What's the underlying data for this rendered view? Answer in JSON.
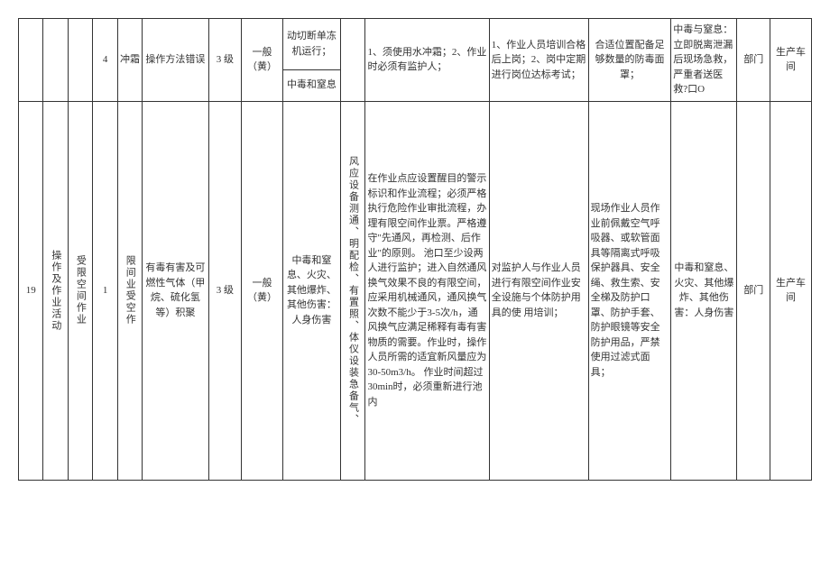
{
  "row0": {
    "c8": "动切断单冻机运行；"
  },
  "row1": {
    "c3": "4",
    "c4": "冲霜",
    "c5": "操作方法错误",
    "c6": "3 级",
    "c7": "一般（黄）",
    "c8": "中毒和窒息",
    "c9": "",
    "c10": "1、须使用水冲霜；2、作业时必须有监护人；",
    "c11": "1、作业人员培训合格后上岗；2、岗中定期进行岗位达标考试；",
    "c12": "合适位置配备足够数量的防毒面罩；",
    "c13": "中毒与窒息：立即脱离泄漏\n后现场急救，严重者送医救?口O",
    "c14": "部门",
    "c15": "生产车间"
  },
  "row2": {
    "c0": "19",
    "c1": "操作及作业活动",
    "c2": "受限空间作业",
    "c3": "1",
    "c4": "限间业受空作",
    "c5": "有毒有害及可燃性气体（甲烷、硫化氢等）积聚",
    "c6": "3 级",
    "c7": "一般（黄）",
    "c8": "中毒和窒息、火灾、其他爆炸、其他伤害：人身伤害",
    "c9": "风应设备测通、明配检、有置照、体仪设装急备气、",
    "c10": "在作业点应设置醒目的警示标识和作业流程；必须严格执行危险作业审批流程，办理有限空间作业票。严格遵守\"先通风，再检测、后作业\"的原则。\n池口至少设两人进行监护；进入自然通风换气效果不良的有限空间，应采用机械通风，通风换气次数不能少于3-5次/h，通风换气应满足稀释有毒有害物质的需要。作业时，操作人员所需的适宜新风量应为30-50m3/h。\n作业时间超过30min时，必须重新进行池内",
    "c11": "对监护人与作业人员进行有限空间作业安全设施与个体防护用具的使\n用培训；",
    "c12": "现场作业人员作业前佩戴空气呼吸器、或软管面具等隔离式呼吸保护器具、安全绳、救生索、安全梯及防护口罩、防护手套、防护眼镜等安全防护用品，严禁使用过滤式面\n具；",
    "c13": "中毒和窒息、火灾、其他爆炸、其他伤害：人身伤害",
    "c14": "部门",
    "c15": "生产车间"
  }
}
